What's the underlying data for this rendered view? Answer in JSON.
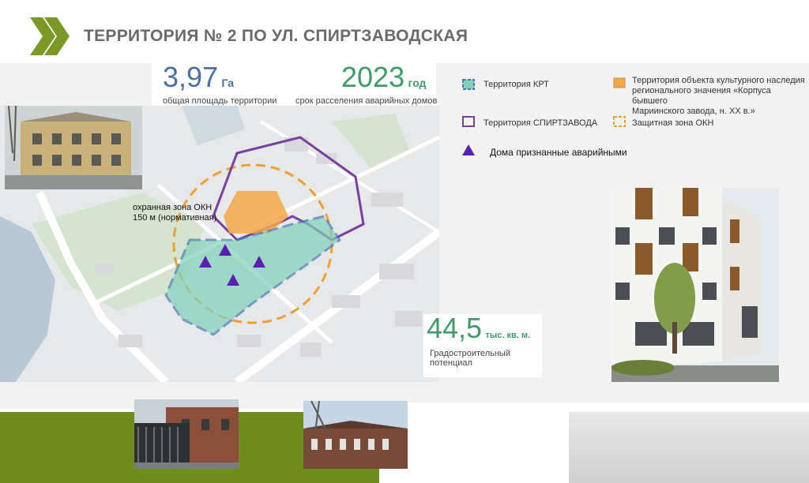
{
  "header": {
    "title": "ТЕРРИТОРИЯ № 2 ПО УЛ. СПИРТЗАВОДСКАЯ"
  },
  "stats": {
    "area": {
      "value": "3,97",
      "unit": "Га",
      "caption": "общая площадь территории"
    },
    "year": {
      "value": "2023",
      "unit": "год",
      "caption": "срок расселения аварийных домов"
    },
    "potential": {
      "value": "44,5",
      "unit": "тыс. кв. м.",
      "caption_line1": "Градостроительный",
      "caption_line2": "потенциал"
    }
  },
  "legend": {
    "krt": "Территория КРТ",
    "spirt": "Территория СПИРТЗАВОДА",
    "houses": "Дома признанные аварийными",
    "okn_line1": "Территория объекта культурного наследия",
    "okn_line2": "регионального значения «Корпуса бывшего",
    "okn_line3": "Мариинского завода, н. XX в.»",
    "zone": "Защитная зона ОКН"
  },
  "map": {
    "zone_label_line1": "охранная зона ОКН",
    "zone_label_line2": "150 м (нормативная)"
  },
  "colors": {
    "brand_green": "#6f8c1f",
    "krt_fill": "#7fd1b9",
    "krt_stroke": "#4a78b4",
    "spirt_stroke": "#7b3fa0",
    "okn_fill": "#f2a74b",
    "houses_marker": "#5a1fb0",
    "blue_number": "#4a6fa5",
    "green_number": "#3f9c6a"
  }
}
